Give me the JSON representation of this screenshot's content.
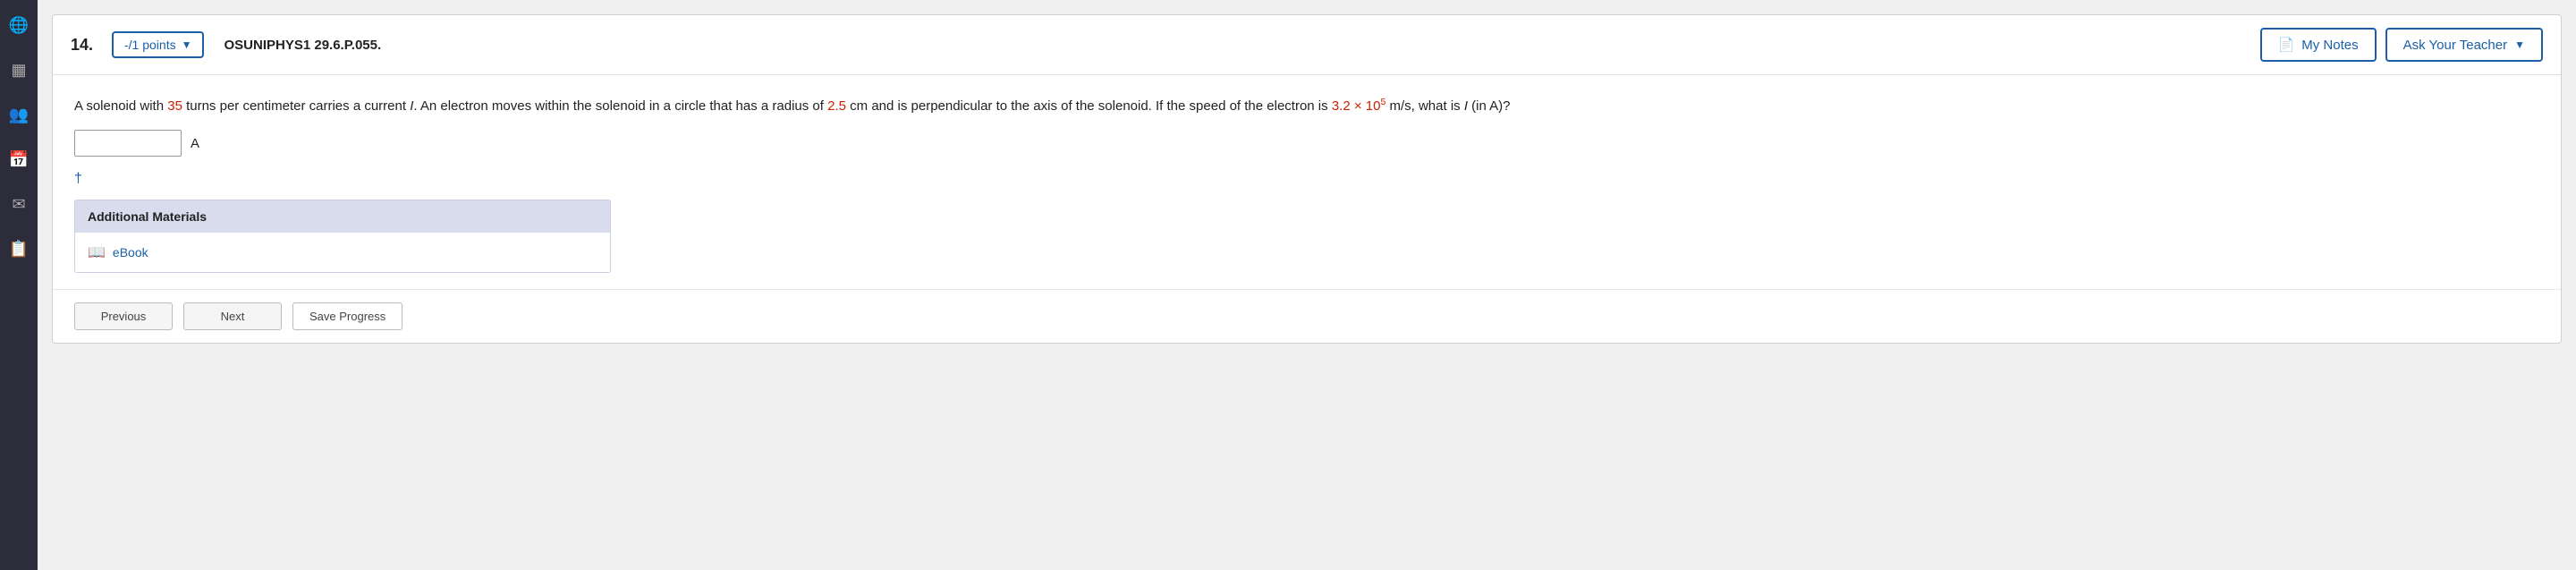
{
  "sidebar": {
    "icons": [
      {
        "name": "globe-icon",
        "symbol": "🌐"
      },
      {
        "name": "layout-icon",
        "symbol": "▦"
      },
      {
        "name": "users-icon",
        "symbol": "👥"
      },
      {
        "name": "calendar-icon",
        "symbol": "📅"
      },
      {
        "name": "mail-icon",
        "symbol": "✉"
      },
      {
        "name": "document-icon",
        "symbol": "📋"
      }
    ]
  },
  "header": {
    "question_number": "14.",
    "points_label": "-/1 points",
    "question_code": "OSUNIPHYS1 29.6.P.055.",
    "my_notes_label": "My Notes",
    "ask_teacher_label": "Ask Your Teacher"
  },
  "question": {
    "text_before_red1": "A solenoid with ",
    "red1": "35",
    "text_after_red1": " turns per centimeter carries a current ",
    "italic1": "I",
    "text2": ". An electron moves within the solenoid in a circle that has a radius of ",
    "red2": "2.5",
    "text3": " cm and is perpendicular to the axis of the solenoid. If the speed of the electron is ",
    "red3_base": "3.2 × 10",
    "red3_exp": "5",
    "text4": " m/s, what is ",
    "italic2": "I",
    "text5": " (in A)?",
    "unit": "A",
    "dagger": "†"
  },
  "additional_materials": {
    "header": "Additional Materials",
    "ebook_label": "eBook"
  },
  "footer": {
    "btn1": "Previous",
    "btn2": "Next",
    "btn3": "Save Progress"
  }
}
